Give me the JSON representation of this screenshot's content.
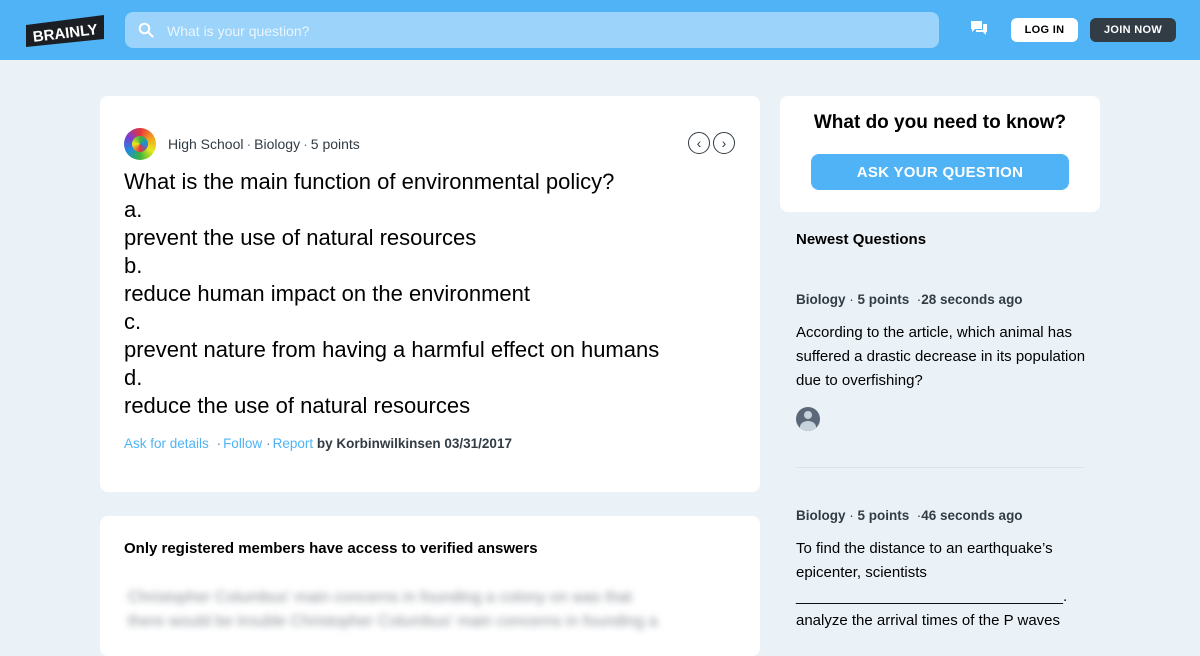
{
  "header": {
    "logo_text": "BRAINLY",
    "search_placeholder": "What is your question?",
    "login_label": "LOG IN",
    "join_label": "JOIN NOW",
    "colors": {
      "bar": "#4fb3f6",
      "join": "#323c45"
    }
  },
  "question": {
    "level": "High School",
    "subject": "Biology",
    "points": "5 points",
    "lines": [
      "What is the main function of environmental policy?",
      "a.",
      "prevent the use of natural resources",
      "b.",
      "reduce human impact on the environment",
      "c.",
      "prevent nature from having a harmful effect on humans",
      "d.",
      "reduce the use of natural resources"
    ],
    "actions": {
      "ask_details": "Ask for details",
      "follow": "Follow",
      "report": "Report",
      "by": "by Korbinwilkinsen 03/31/2017"
    }
  },
  "answer": {
    "title": "Only registered members have access to verified answers",
    "blurred_lines": [
      "Christopher Columbus' main concerns in founding a colony on was that",
      "there would be trouble Christopher Columbus' main concerns in founding a"
    ]
  },
  "sidebar": {
    "ask_title": "What do you need to know?",
    "ask_button": "ASK YOUR QUESTION",
    "newest_title": "Newest Questions",
    "questions": [
      {
        "subject": "Biology",
        "points": "5 points",
        "time": "28 seconds ago",
        "text": "According to the article, which animal has suffered a drastic decrease in its population due to overfishing?"
      },
      {
        "subject": "Biology",
        "points": "5 points",
        "time": "46 seconds ago",
        "text": "To find the distance to an earthquake’s epicenter, scientists ________________________________. analyze the arrival times of the P waves"
      }
    ]
  }
}
